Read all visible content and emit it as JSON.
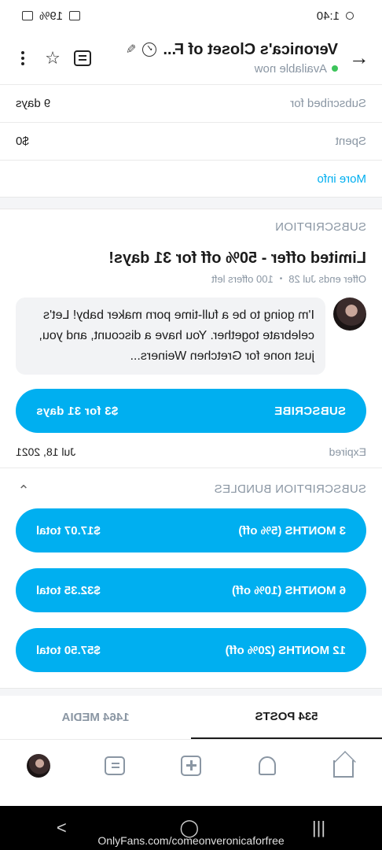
{
  "status_bar": {
    "time": "1:40",
    "battery": "19%"
  },
  "header": {
    "title": "Veronica's Closet of F...",
    "status": "Available now",
    "back_icon": "arrow-back-icon",
    "verified_icon": "verified-badge-icon"
  },
  "info": {
    "subscribed_label": "Subscribed for",
    "subscribed_value": "9 days",
    "spent_label": "Spent",
    "spent_value": "$0",
    "more_info": "More info"
  },
  "subscription": {
    "section_title": "SUBSCRIPTION",
    "offer_title": "Limited offer - 50% off for 31 days!",
    "offer_ends": "Offer ends Jul 28",
    "offers_left": "100 offers left",
    "message": "I'm going to be a full-time porn maker baby! Let's celebrate together. You have a discount, and you, just none for Gretchen Weiners...",
    "subscribe_label": "SUBSCRIBE",
    "subscribe_price": "$3 for 31 days",
    "expired_label": "Expired",
    "expired_date": "Jul 18, 2021"
  },
  "bundles": {
    "section_title": "SUBSCRIPTION BUNDLES",
    "items": [
      {
        "label": "3 MONTHS (5% off)",
        "price": "$17.07 total"
      },
      {
        "label": "6 MONTHS (10% off)",
        "price": "$32.35 total"
      },
      {
        "label": "12 MONTHS (20% off)",
        "price": "$57.50 total"
      }
    ]
  },
  "tabs": [
    {
      "label": "534 POSTS",
      "active": true
    },
    {
      "label": "1464 MEDIA",
      "active": false
    }
  ],
  "bottom_nav": [
    "home-icon",
    "bell-icon",
    "add-icon",
    "messages-icon",
    "profile-avatar"
  ],
  "system": {
    "url_overlay": "OnlyFans.com/comeonveronicaforfree"
  },
  "colors": {
    "accent": "#00aff0",
    "muted": "#8a96a3",
    "online": "#3dc45b"
  }
}
